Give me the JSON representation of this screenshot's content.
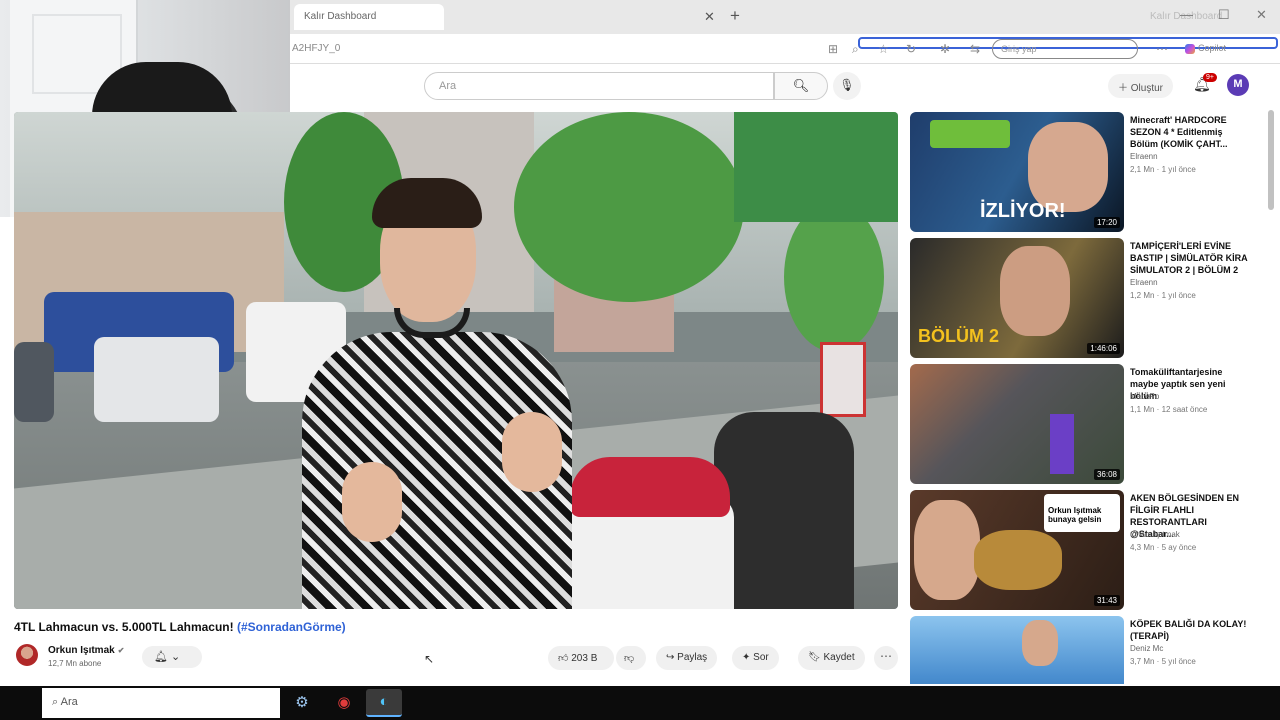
{
  "browser": {
    "tab_title": "Kalır Dashboard",
    "window_title": "Kalır Dashboard",
    "url": "A2HFJY_0",
    "profile": "Giriş yap",
    "copilot_label": "Copilot"
  },
  "youtube": {
    "search_placeholder": "Ara",
    "create_label": "Oluştur",
    "notification_count": "9+",
    "avatar_letter": "M"
  },
  "video": {
    "title_main": "4TL Lahmacun vs. 5.000TL Lahmacun! ",
    "title_hashtag": "(#SonradanGörme)",
    "channel": "Orkun Işıtmak",
    "subscribers": "12,7 Mn abone",
    "like_count": "203 B",
    "share_label": "Paylaş",
    "ask_label": "Sor",
    "save_label": "Kaydet"
  },
  "recommendations": [
    {
      "title": "Minecraft' HARDCORE SEZON 4 * Editlenmiş Bölüm (KOMİK ÇAHT...",
      "channel": "Elraenn",
      "meta": "2,1 Mn · 1 yıl önce",
      "duration": "17:20",
      "thumb_text": "İZLİYOR!"
    },
    {
      "title": "TAMPİÇERİ'LERİ EVİNE BASTIP | SİMÜLATÖR KİRA SİMULATOR 2 | BÖLÜM 2",
      "channel": "Elraenn",
      "meta": "1,2 Mn · 1 yıl önce",
      "duration": "1:46:06",
      "thumb_text": "BÖLÜM 2"
    },
    {
      "title": "Tomaküliftantarjesine maybe yaptık sen yeni bölüm",
      "channel": "MacePo",
      "meta": "1,1 Mn · 12 saat önce",
      "duration": "36:08",
      "thumb_text": ""
    },
    {
      "title": "AKEN BÖLGESİNDEN EN FİLGİR FLAHLI RESTORANTLARI @Stabar...",
      "channel": "Orkun Işıtmak",
      "meta": "4,3 Mn · 5 ay önce",
      "duration": "31:43",
      "thumb_text": "Orkun Işıtmak bunaya gelsin"
    },
    {
      "title": "KÖPEK BALIĞI DA KOLAY! (TERAPİ)",
      "channel": "Deniz Mc",
      "meta": "3,7 Mn · 5 yıl önce",
      "duration": "",
      "thumb_text": ""
    }
  ],
  "taskbar": {
    "search_placeholder": "Ara"
  }
}
